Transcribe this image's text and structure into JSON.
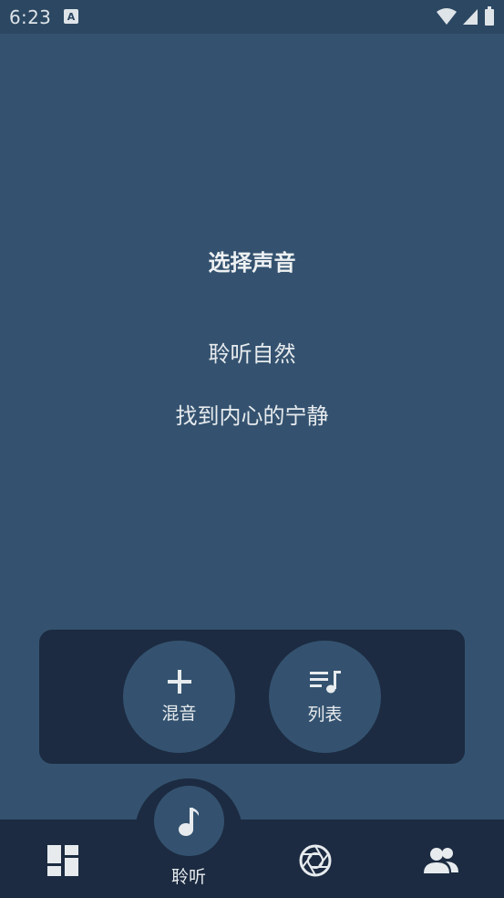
{
  "status_bar": {
    "time": "6:23",
    "notification_icon": "a-box-icon",
    "wifi_icon": "wifi-icon",
    "signal_icon": "signal-icon",
    "battery_icon": "battery-icon"
  },
  "main": {
    "title": "选择声音",
    "line1": "聆听自然",
    "line2": "找到内心的宁静"
  },
  "panel": {
    "mix_label": "混音",
    "list_label": "列表"
  },
  "bottom_nav": {
    "items": [
      {
        "icon": "dashboard-icon"
      },
      {
        "icon": "music-note-icon",
        "label": "聆听",
        "active": true
      },
      {
        "icon": "aperture-icon"
      },
      {
        "icon": "people-icon"
      }
    ]
  },
  "colors": {
    "background": "#34526f",
    "status_bar": "#2b4762",
    "panel": "#1c2b41",
    "text": "#e7ebee"
  }
}
